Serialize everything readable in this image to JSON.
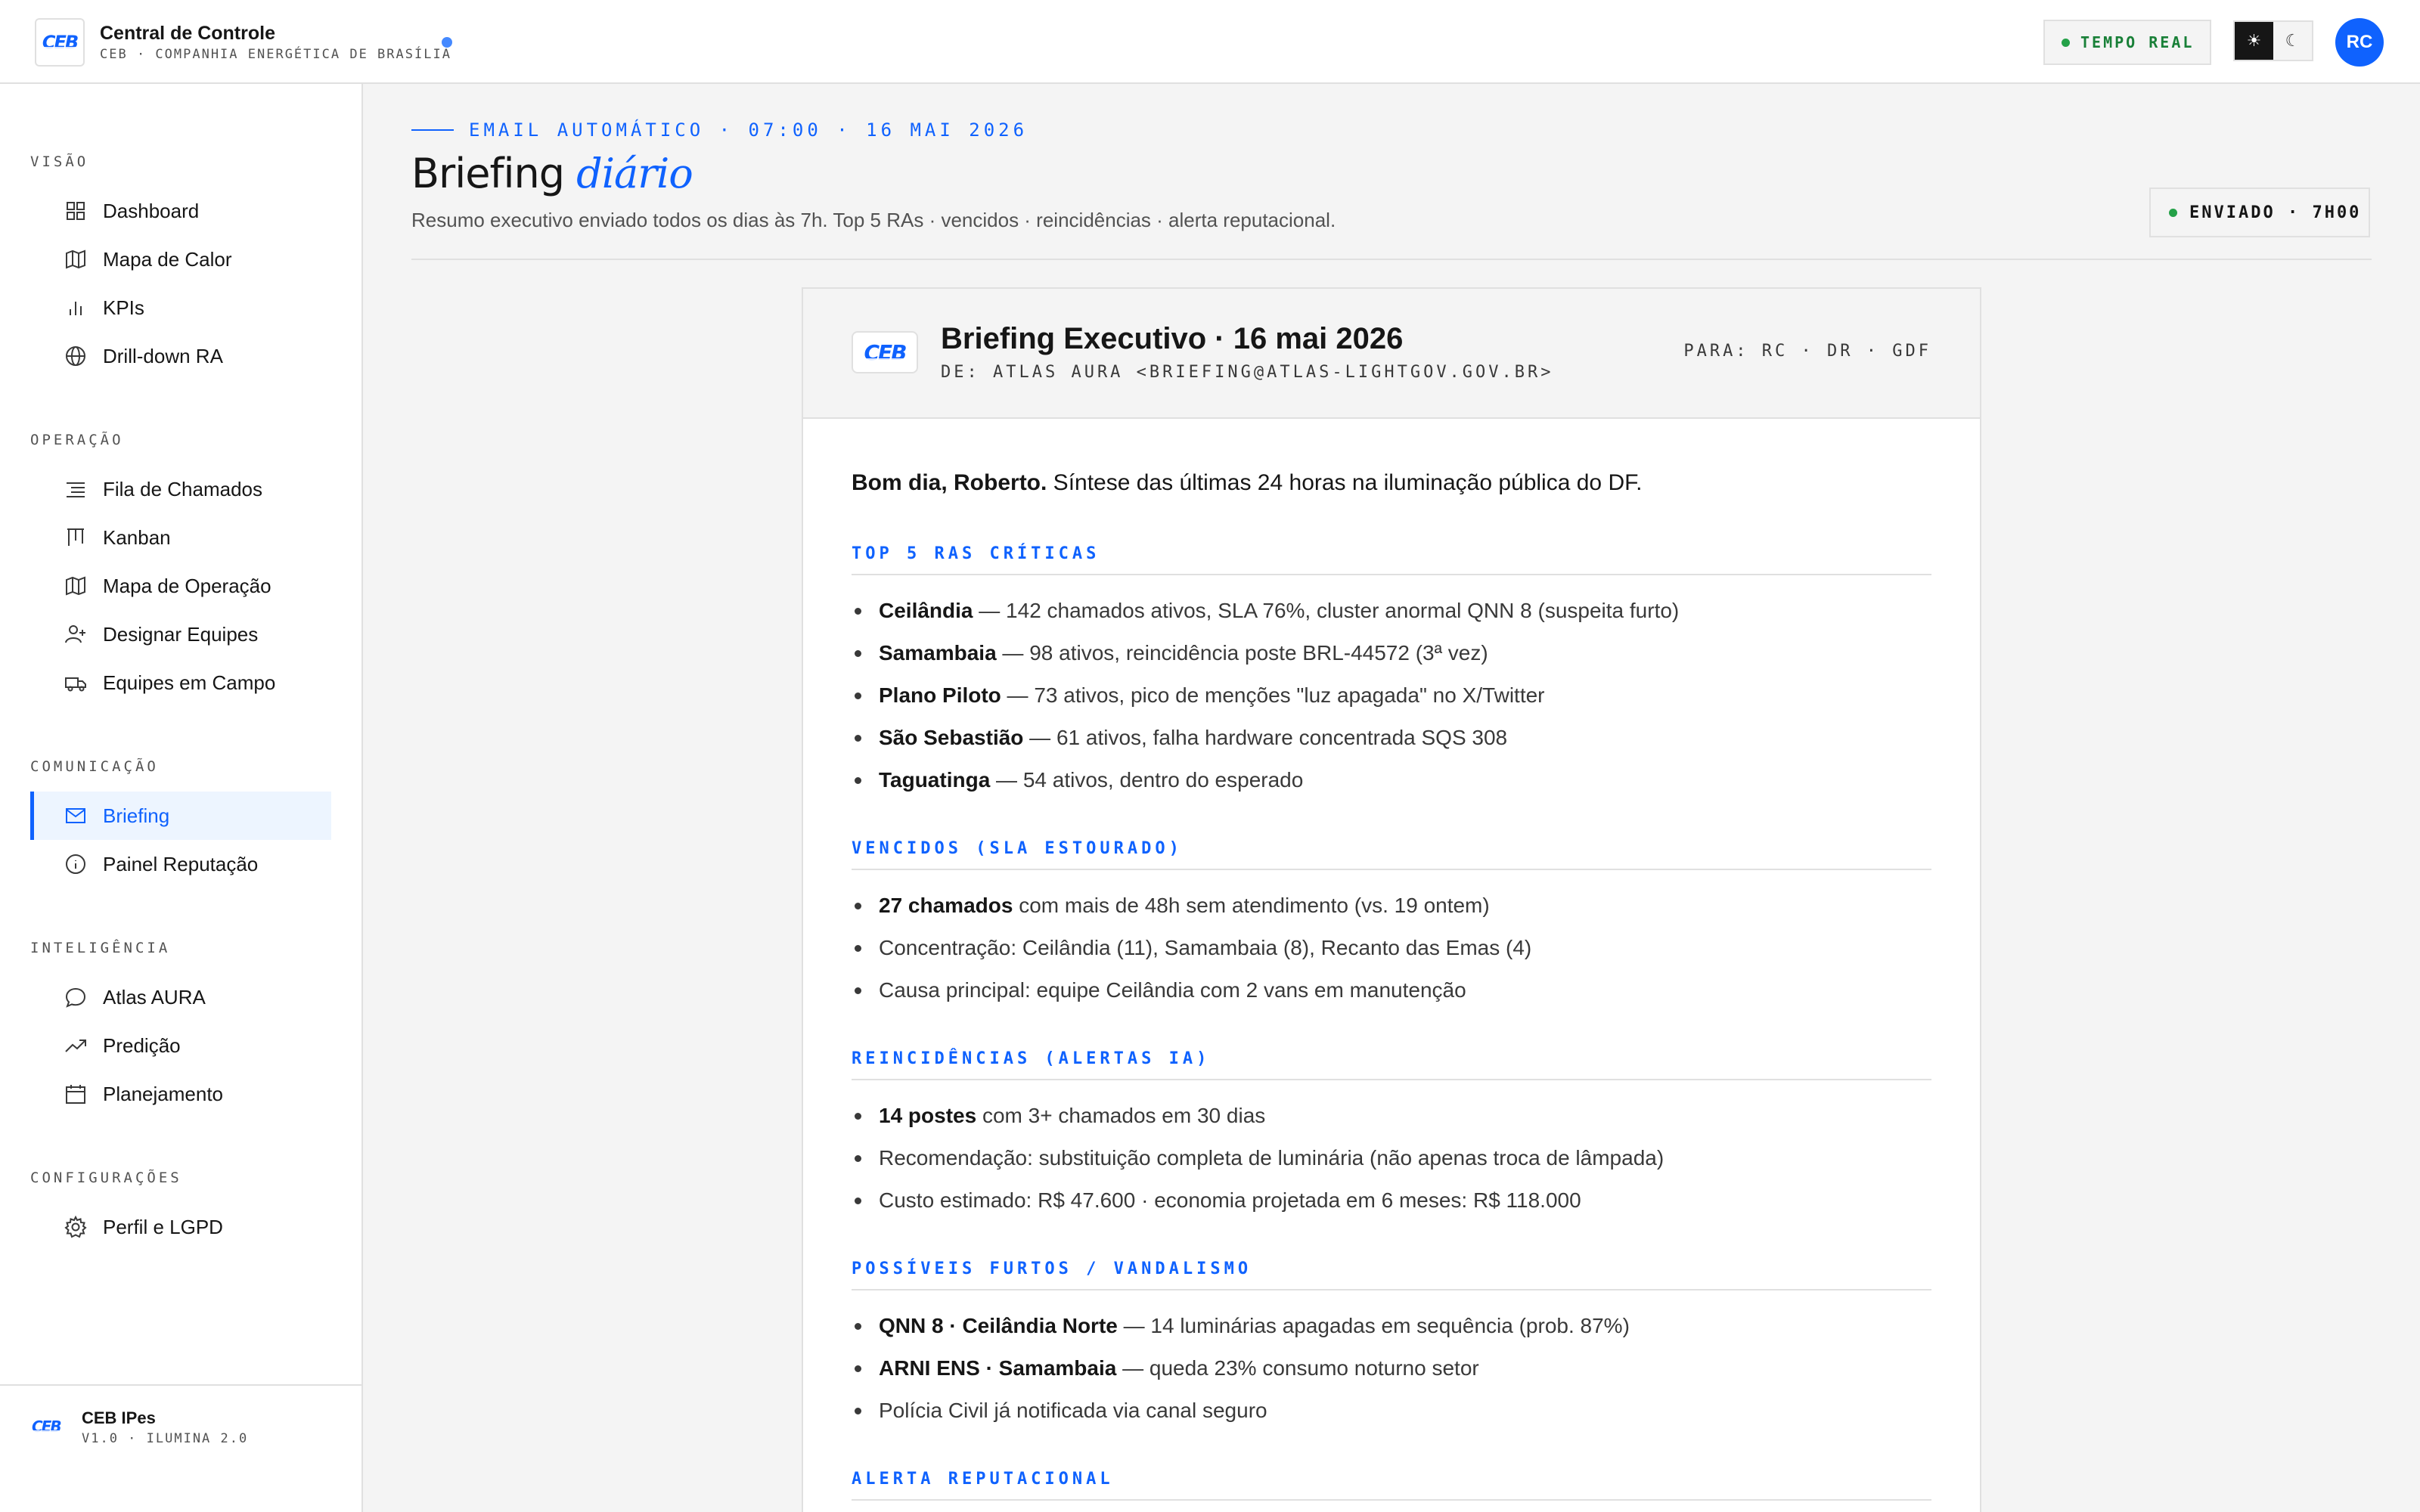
{
  "header": {
    "logo_text": "CEB",
    "title": "Central de Controle",
    "subtitle": "CEB · COMPANHIA ENERGÉTICA DE BRASÍLIA",
    "realtime_label": "TEMPO REAL",
    "theme_light_icon": "☀",
    "theme_dark_icon": "☾",
    "avatar_initials": "RC"
  },
  "sidebar": {
    "sections": {
      "visao": "VISÃO",
      "operacao": "OPERAÇÃO",
      "comunicacao": "COMUNICAÇÃO",
      "inteligencia": "INTELIGÊNCIA",
      "configuracoes": "CONFIGURAÇÕES"
    },
    "items": [
      {
        "label": "Dashboard",
        "icon": "grid-icon"
      },
      {
        "label": "Mapa de Calor",
        "icon": "map-icon"
      },
      {
        "label": "KPIs",
        "icon": "bar-chart-icon"
      },
      {
        "label": "Drill-down RA",
        "icon": "globe-icon"
      },
      {
        "label": "Fila de Chamados",
        "icon": "list-icon"
      },
      {
        "label": "Kanban",
        "icon": "kanban-icon"
      },
      {
        "label": "Mapa de Operação",
        "icon": "map-icon"
      },
      {
        "label": "Designar Equipes",
        "icon": "user-add-icon"
      },
      {
        "label": "Equipes em Campo",
        "icon": "truck-icon"
      },
      {
        "label": "Briefing",
        "icon": "mail-icon",
        "active": true
      },
      {
        "label": "Painel Reputação",
        "icon": "info-circle-icon"
      },
      {
        "label": "Atlas AURA",
        "icon": "chat-icon"
      },
      {
        "label": "Predição",
        "icon": "trend-icon"
      },
      {
        "label": "Planejamento",
        "icon": "calendar-icon"
      },
      {
        "label": "Perfil e LGPD",
        "icon": "gear-icon"
      }
    ],
    "footer": {
      "logo_text": "CEB",
      "name": "CEB IPes",
      "version": "V1.0 · ILUMINA 2.0"
    }
  },
  "page": {
    "eyebrow": "EMAIL AUTOMÁTICO · 07:00 · 16 MAI 2026",
    "title_plain": "Briefing ",
    "title_accent": "diário",
    "description": "Resumo executivo enviado todos os dias às 7h. Top 5 RAs · vencidos · reincidências · alerta reputacional.",
    "sent_badge": "ENVIADO · 7H00"
  },
  "email": {
    "logo_text": "CEB",
    "subject": "Briefing Executivo · 16 mai 2026",
    "from": "DE: ATLAS AURA <BRIEFING@ATLAS-LIGHTGOV.GOV.BR>",
    "to": "PARA: RC · DR · GDF",
    "greeting_bold": "Bom dia, Roberto.",
    "greeting_rest": " Síntese das últimas 24 horas na iluminação pública do DF.",
    "sections": [
      {
        "title": "TOP 5 RAS CRÍTICAS",
        "items": [
          {
            "bold": "Ceilândia",
            "rest": " — 142 chamados ativos, SLA 76%, cluster anormal QNN 8 (suspeita furto)"
          },
          {
            "bold": "Samambaia",
            "rest": " — 98 ativos, reincidência poste BRL-44572 (3ª vez)"
          },
          {
            "bold": "Plano Piloto",
            "rest": " — 73 ativos, pico de menções \"luz apagada\" no X/Twitter"
          },
          {
            "bold": "São Sebastião",
            "rest": " — 61 ativos, falha hardware concentrada SQS 308"
          },
          {
            "bold": "Taguatinga",
            "rest": " — 54 ativos, dentro do esperado"
          }
        ]
      },
      {
        "title": "VENCIDOS (SLA ESTOURADO)",
        "items": [
          {
            "bold": "27 chamados",
            "rest": " com mais de 48h sem atendimento (vs. 19 ontem)"
          },
          {
            "bold": "",
            "rest": "Concentração: Ceilândia (11), Samambaia (8), Recanto das Emas (4)"
          },
          {
            "bold": "",
            "rest": "Causa principal: equipe Ceilândia com 2 vans em manutenção"
          }
        ]
      },
      {
        "title": "REINCIDÊNCIAS (ALERTAS IA)",
        "items": [
          {
            "bold": "14 postes",
            "rest": " com 3+ chamados em 30 dias"
          },
          {
            "bold": "",
            "rest": "Recomendação: substituição completa de luminária (não apenas troca de lâmpada)"
          },
          {
            "bold": "",
            "rest": "Custo estimado: R$ 47.600 · economia projetada em 6 meses: R$ 118.000"
          }
        ]
      },
      {
        "title": "POSSÍVEIS FURTOS / VANDALISMO",
        "items": [
          {
            "bold": "QNN 8 · Ceilândia Norte",
            "rest": " — 14 luminárias apagadas em sequência (prob. 87%)"
          },
          {
            "bold": "ARNI ENS · Samambaia",
            "rest": " — queda 23% consumo noturno setor"
          },
          {
            "bold": "",
            "rest": "Polícia Civil já notificada via canal seguro"
          }
        ]
      },
      {
        "title": "ALERTA REPUTACIONAL",
        "items": []
      }
    ]
  },
  "colors": {
    "accent": "#0f62fe",
    "status_green": "#24a148",
    "border": "#e0e0e0",
    "background": "#f4f4f4"
  }
}
